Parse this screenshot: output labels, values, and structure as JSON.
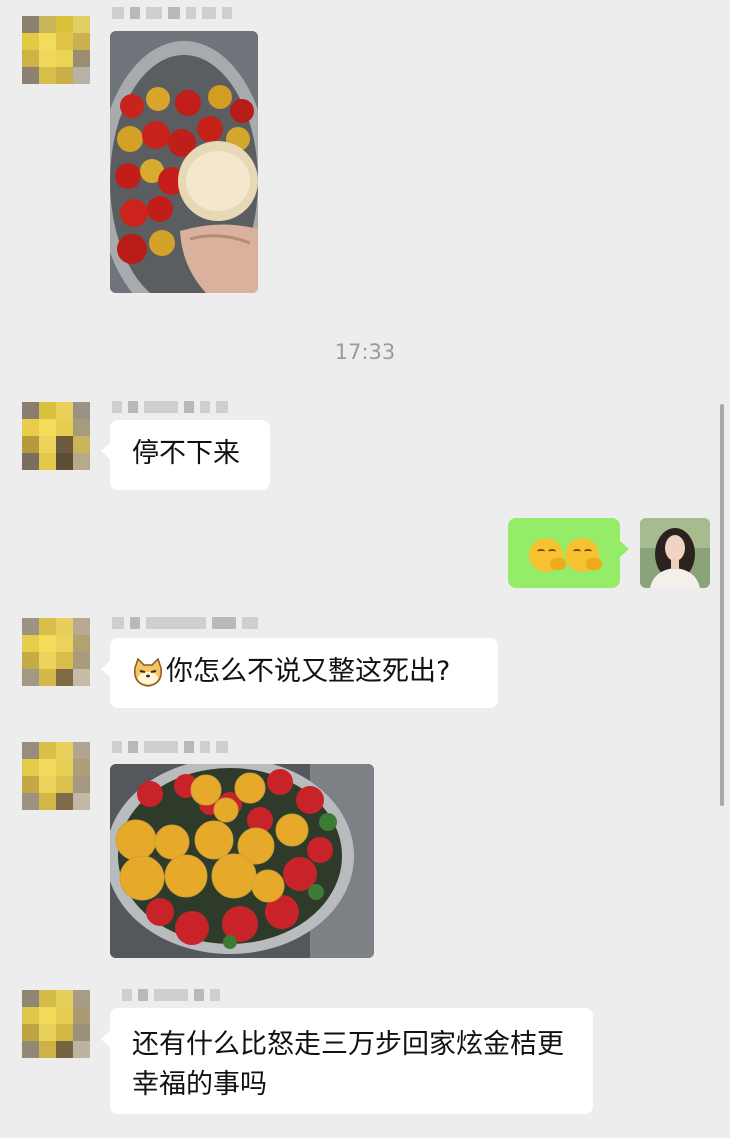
{
  "chat": {
    "timestamp": "17:33",
    "messages": [
      {
        "id": 1,
        "type": "image",
        "side": "left",
        "content": "strawberries and pear in metal bowl"
      },
      {
        "id": 2,
        "type": "text",
        "side": "left",
        "text": "停不下来"
      },
      {
        "id": 3,
        "type": "emoji",
        "side": "right",
        "content": "two giggling face emojis"
      },
      {
        "id": 4,
        "type": "text",
        "side": "left",
        "prefix_emoji": "cat-face",
        "text": "你怎么不说又整这死出?"
      },
      {
        "id": 5,
        "type": "image",
        "side": "left",
        "content": "strawberries and kumquats in metal bowl"
      },
      {
        "id": 6,
        "type": "text",
        "side": "left",
        "text": "还有什么比怒走三万步回家炫金桔更幸福的事吗"
      }
    ]
  },
  "colors": {
    "background": "#ededed",
    "incoming_bubble": "#ffffff",
    "outgoing_bubble": "#95ec69",
    "timestamp_text": "#9b9b9b"
  }
}
